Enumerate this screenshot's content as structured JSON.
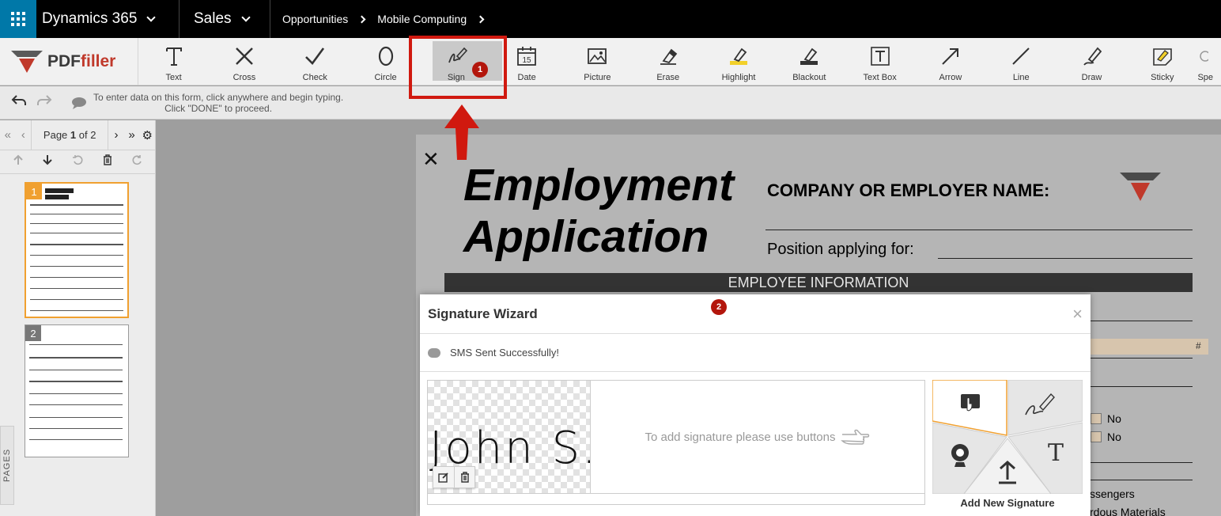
{
  "topnav": {
    "app_name": "Dynamics 365",
    "module": "Sales",
    "breadcrumbs": [
      "Opportunities",
      "Mobile Computing"
    ]
  },
  "toolbar": {
    "logo_text": "PDFfiller",
    "tools": [
      {
        "label": "Text",
        "icon": "text-icon"
      },
      {
        "label": "Cross",
        "icon": "cross-icon"
      },
      {
        "label": "Check",
        "icon": "check-icon"
      },
      {
        "label": "Circle",
        "icon": "circle-icon"
      },
      {
        "label": "Sign",
        "icon": "sign-icon",
        "active": true
      },
      {
        "label": "Date",
        "icon": "date-icon"
      },
      {
        "label": "Picture",
        "icon": "picture-icon"
      },
      {
        "label": "Erase",
        "icon": "erase-icon"
      },
      {
        "label": "Highlight",
        "icon": "highlight-icon"
      },
      {
        "label": "Blackout",
        "icon": "blackout-icon"
      },
      {
        "label": "Text Box",
        "icon": "text-box-icon"
      },
      {
        "label": "Arrow",
        "icon": "arrow-icon"
      },
      {
        "label": "Line",
        "icon": "line-icon"
      },
      {
        "label": "Draw",
        "icon": "draw-icon"
      },
      {
        "label": "Sticky",
        "icon": "sticky-icon"
      },
      {
        "label": "Spe",
        "icon": "special-icon"
      }
    ],
    "date_icon_number": "15"
  },
  "hint": {
    "line1": "To enter data on this form, click anywhere and begin typing.",
    "line2": "Click \"DONE\" to proceed."
  },
  "pager": {
    "prefix": "Page",
    "current": "1",
    "of": "of 2"
  },
  "thumbnails": [
    {
      "num": "1",
      "active": true
    },
    {
      "num": "2",
      "active": false
    }
  ],
  "pages_tab": "PAGES",
  "document": {
    "title_line1": "Employment",
    "title_line2": "Application",
    "company_label": "COMPANY OR EMPLOYER NAME:",
    "position_label": "Position applying for:",
    "section_bar": "EMPLOYEE INFORMATION",
    "hash": "#",
    "no1": "No",
    "no2": "No",
    "extra1": "ssengers",
    "extra2": "rdous Materials"
  },
  "wizard": {
    "title": "Signature Wizard",
    "message": "SMS Sent Successfully!",
    "signature_text": "John S.",
    "hint": "To add signature please use buttons",
    "add_label": "Add New Signature"
  },
  "annotations": {
    "badge1": "1",
    "badge2": "2"
  },
  "colors": {
    "accent_blue": "#0078a8",
    "annotation_red": "#d0190f",
    "active_tile": "#f0a030"
  }
}
